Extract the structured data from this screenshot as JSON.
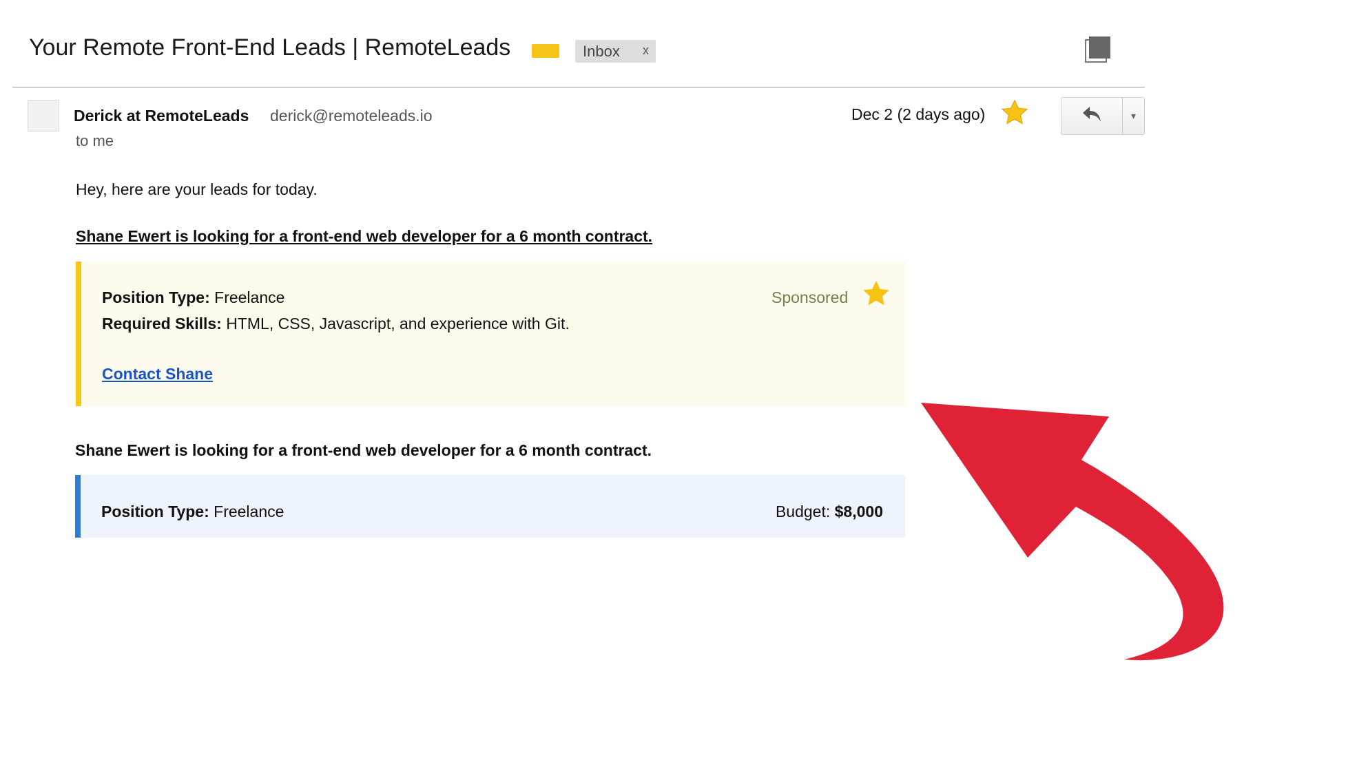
{
  "header": {
    "subject": "Your Remote Front-End Leads | RemoteLeads",
    "inbox_label": "Inbox",
    "inbox_remove": "x",
    "label_color": "#f5c518"
  },
  "message": {
    "sender_name": "Derick at RemoteLeads",
    "sender_email": "derick@remoteleads.io",
    "recipient": "to me",
    "date": "Dec 2 (2 days ago)",
    "starred": true
  },
  "toolbar": {
    "reply_icon": "reply-icon",
    "more_icon": "▾",
    "print_icon": "print-icon"
  },
  "body": {
    "greeting": "Hey, here are your leads for today.",
    "lead1": {
      "heading": "Shane Ewert is looking for a front-end web developer for a 6 month contract.",
      "position_type_label": "Position Type:",
      "position_type_value": " Freelance",
      "skills_label": "Required Skills:",
      "skills_value": " HTML, CSS, Javascript, and experience with Git.",
      "sponsored": "Sponsored",
      "contact": "Contact Shane",
      "accent_color": "#f5c518"
    },
    "lead2": {
      "heading": "Shane Ewert is looking for a front-end web developer for a 6 month contract.",
      "position_type_label": "Position Type:",
      "position_type_value": " Freelance",
      "budget_label": "Budget: ",
      "budget_value": "$8,000",
      "accent_color": "#2d7bd4"
    }
  },
  "annotation": {
    "arrow_color": "#e02236"
  }
}
